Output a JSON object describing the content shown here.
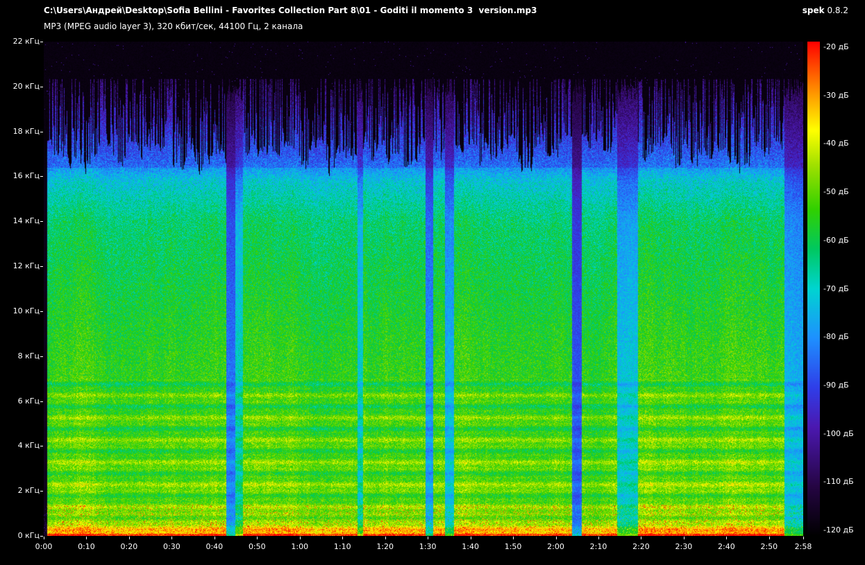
{
  "header": {
    "file_path": "C:\\Users\\Андрей\\Desktop\\Sofia Bellini - Favorites Collection Part 8\\01 - Goditi il momento 3  version.mp3",
    "app_name": "spek",
    "app_version": "0.8.2",
    "file_info": "MP3 (MPEG audio layer 3), 320 кбит/сек, 44100 Гц, 2 канала"
  },
  "chart": {
    "type": "heatmap",
    "description": "audio spectrogram",
    "freq_axis": {
      "unit": "кГц",
      "min": 0,
      "max": 22,
      "tick_step": 2,
      "values": [
        22,
        20,
        18,
        16,
        14,
        12,
        10,
        8,
        6,
        4,
        2,
        0
      ],
      "labels": [
        "22 кГц",
        "20 кГц",
        "18 кГц",
        "16 кГц",
        "14 кГц",
        "12 кГц",
        "10 кГц",
        "8 кГц",
        "6 кГц",
        "4 кГц",
        "2 кГц",
        "0 кГц"
      ]
    },
    "time_axis": {
      "duration_seconds": 178,
      "seconds": [
        0,
        10,
        20,
        30,
        40,
        50,
        60,
        70,
        80,
        90,
        100,
        110,
        120,
        130,
        140,
        150,
        160,
        170,
        178
      ],
      "labels": [
        "0:00",
        "0:10",
        "0:20",
        "0:30",
        "0:40",
        "0:50",
        "1:00",
        "1:10",
        "1:20",
        "1:30",
        "1:40",
        "1:50",
        "2:00",
        "2:10",
        "2:20",
        "2:30",
        "2:40",
        "2:50",
        "2:58"
      ]
    },
    "db_scale": {
      "unit": "дБ",
      "max": -20,
      "min": -120,
      "step": -10,
      "labels": [
        "-20 дБ",
        "-30 дБ",
        "-40 дБ",
        "-50 дБ",
        "-60 дБ",
        "-70 дБ",
        "-80 дБ",
        "-90 дБ",
        "-100 дБ",
        "-110 дБ",
        "-120 дБ"
      ]
    },
    "palette": [
      {
        "t": 0.0,
        "color": "#000000"
      },
      {
        "t": 0.1,
        "color": "#250543"
      },
      {
        "t": 0.22,
        "color": "#4b18b0"
      },
      {
        "t": 0.3,
        "color": "#2f3ee8"
      },
      {
        "t": 0.4,
        "color": "#1e90ff"
      },
      {
        "t": 0.5,
        "color": "#00d4d0"
      },
      {
        "t": 0.58,
        "color": "#00c860"
      },
      {
        "t": 0.66,
        "color": "#30d000"
      },
      {
        "t": 0.75,
        "color": "#a0e000"
      },
      {
        "t": 0.82,
        "color": "#ffff00"
      },
      {
        "t": 0.9,
        "color": "#ff9000"
      },
      {
        "t": 1.0,
        "color": "#ff0000"
      }
    ],
    "background_color": "#000000",
    "text_color": "#ffffff"
  }
}
